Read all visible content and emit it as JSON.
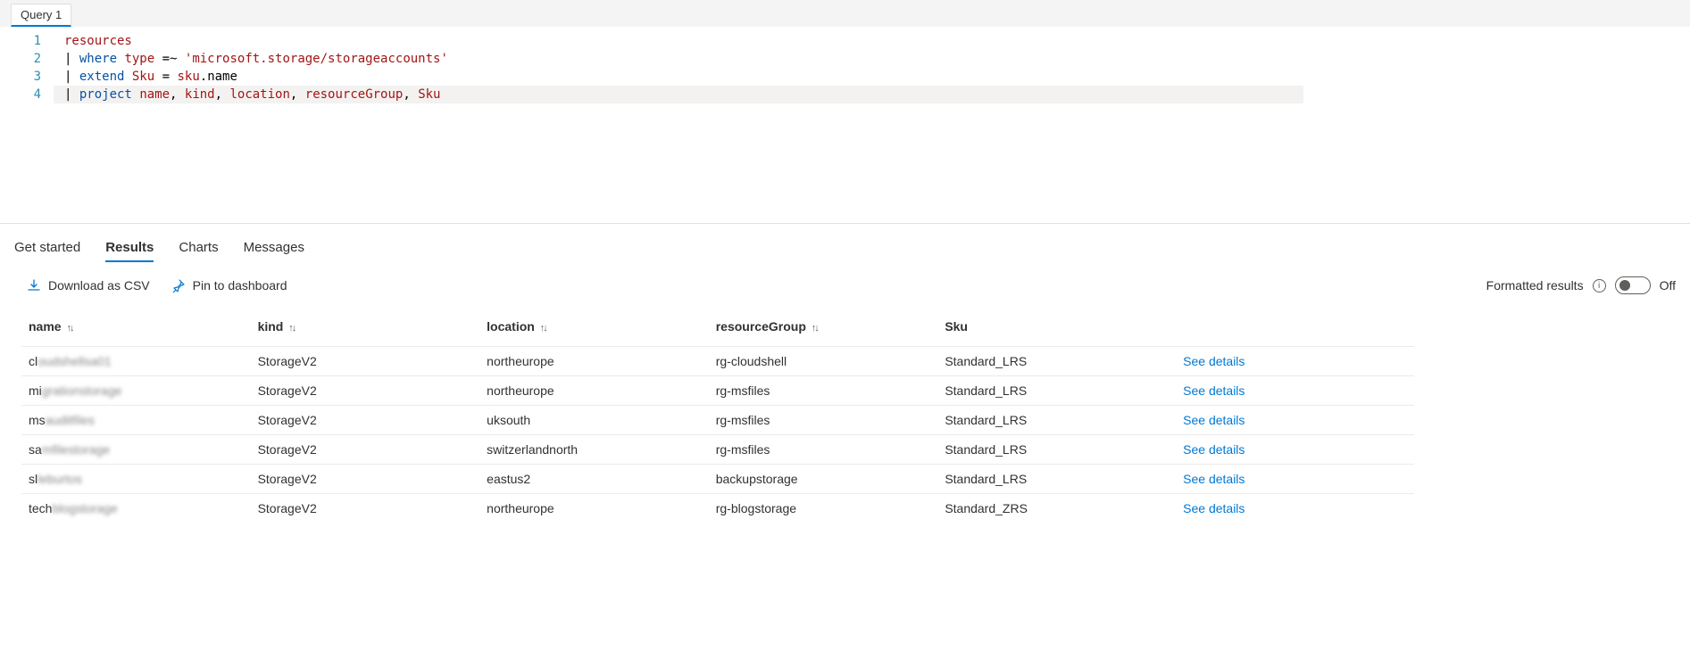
{
  "tab": {
    "label": "Query 1"
  },
  "editor": {
    "lines": [
      {
        "n": "1",
        "tokens": [
          {
            "t": "resources",
            "c": "id"
          }
        ]
      },
      {
        "n": "2",
        "tokens": [
          {
            "t": "| ",
            "c": "op"
          },
          {
            "t": "where",
            "c": "kw"
          },
          {
            "t": " ",
            "c": "op"
          },
          {
            "t": "type",
            "c": "id"
          },
          {
            "t": " =~ ",
            "c": "op"
          },
          {
            "t": "'microsoft.storage/storageaccounts'",
            "c": "str"
          }
        ]
      },
      {
        "n": "3",
        "tokens": [
          {
            "t": "| ",
            "c": "op"
          },
          {
            "t": "extend",
            "c": "kw"
          },
          {
            "t": " ",
            "c": "op"
          },
          {
            "t": "Sku",
            "c": "id"
          },
          {
            "t": " = ",
            "c": "op"
          },
          {
            "t": "sku",
            "c": "id"
          },
          {
            "t": ".name",
            "c": "op"
          }
        ]
      },
      {
        "n": "4",
        "tokens": [
          {
            "t": "| ",
            "c": "op"
          },
          {
            "t": "project",
            "c": "kw"
          },
          {
            "t": " ",
            "c": "op"
          },
          {
            "t": "name",
            "c": "id"
          },
          {
            "t": ", ",
            "c": "op"
          },
          {
            "t": "kind",
            "c": "id"
          },
          {
            "t": ", ",
            "c": "op"
          },
          {
            "t": "location",
            "c": "id"
          },
          {
            "t": ", ",
            "c": "op"
          },
          {
            "t": "resourceGroup",
            "c": "id"
          },
          {
            "t": ", ",
            "c": "op"
          },
          {
            "t": "Sku",
            "c": "id"
          }
        ],
        "highlight": true
      }
    ]
  },
  "resultsTabs": {
    "getStarted": "Get started",
    "results": "Results",
    "charts": "Charts",
    "messages": "Messages"
  },
  "toolbar": {
    "downloadCsv": "Download as CSV",
    "pinDashboard": "Pin to dashboard",
    "formattedResults": "Formatted results",
    "toggleState": "Off"
  },
  "columns": {
    "name": "name",
    "kind": "kind",
    "location": "location",
    "resourceGroup": "resourceGroup",
    "sku": "Sku",
    "sort": "↑↓"
  },
  "rows": [
    {
      "name_prefix": "cl",
      "name_blur": "oudshellsa01",
      "kind": "StorageV2",
      "location": "northeurope",
      "resourceGroup": "rg-cloudshell",
      "sku": "Standard_LRS"
    },
    {
      "name_prefix": "mi",
      "name_blur": "grationstorage",
      "kind": "StorageV2",
      "location": "northeurope",
      "resourceGroup": "rg-msfiles",
      "sku": "Standard_LRS"
    },
    {
      "name_prefix": "ms",
      "name_blur": "auditfiles",
      "kind": "StorageV2",
      "location": "uksouth",
      "resourceGroup": "rg-msfiles",
      "sku": "Standard_LRS"
    },
    {
      "name_prefix": "sa",
      "name_blur": "mfilestorage",
      "kind": "StorageV2",
      "location": "switzerlandnorth",
      "resourceGroup": "rg-msfiles",
      "sku": "Standard_LRS"
    },
    {
      "name_prefix": "sl",
      "name_blur": "leburtos",
      "kind": "StorageV2",
      "location": "eastus2",
      "resourceGroup": "backupstorage",
      "sku": "Standard_LRS"
    },
    {
      "name_prefix": "tech",
      "name_blur": "blogstorage",
      "kind": "StorageV2",
      "location": "northeurope",
      "resourceGroup": "rg-blogstorage",
      "sku": "Standard_ZRS"
    }
  ],
  "detailsLabel": "See details"
}
